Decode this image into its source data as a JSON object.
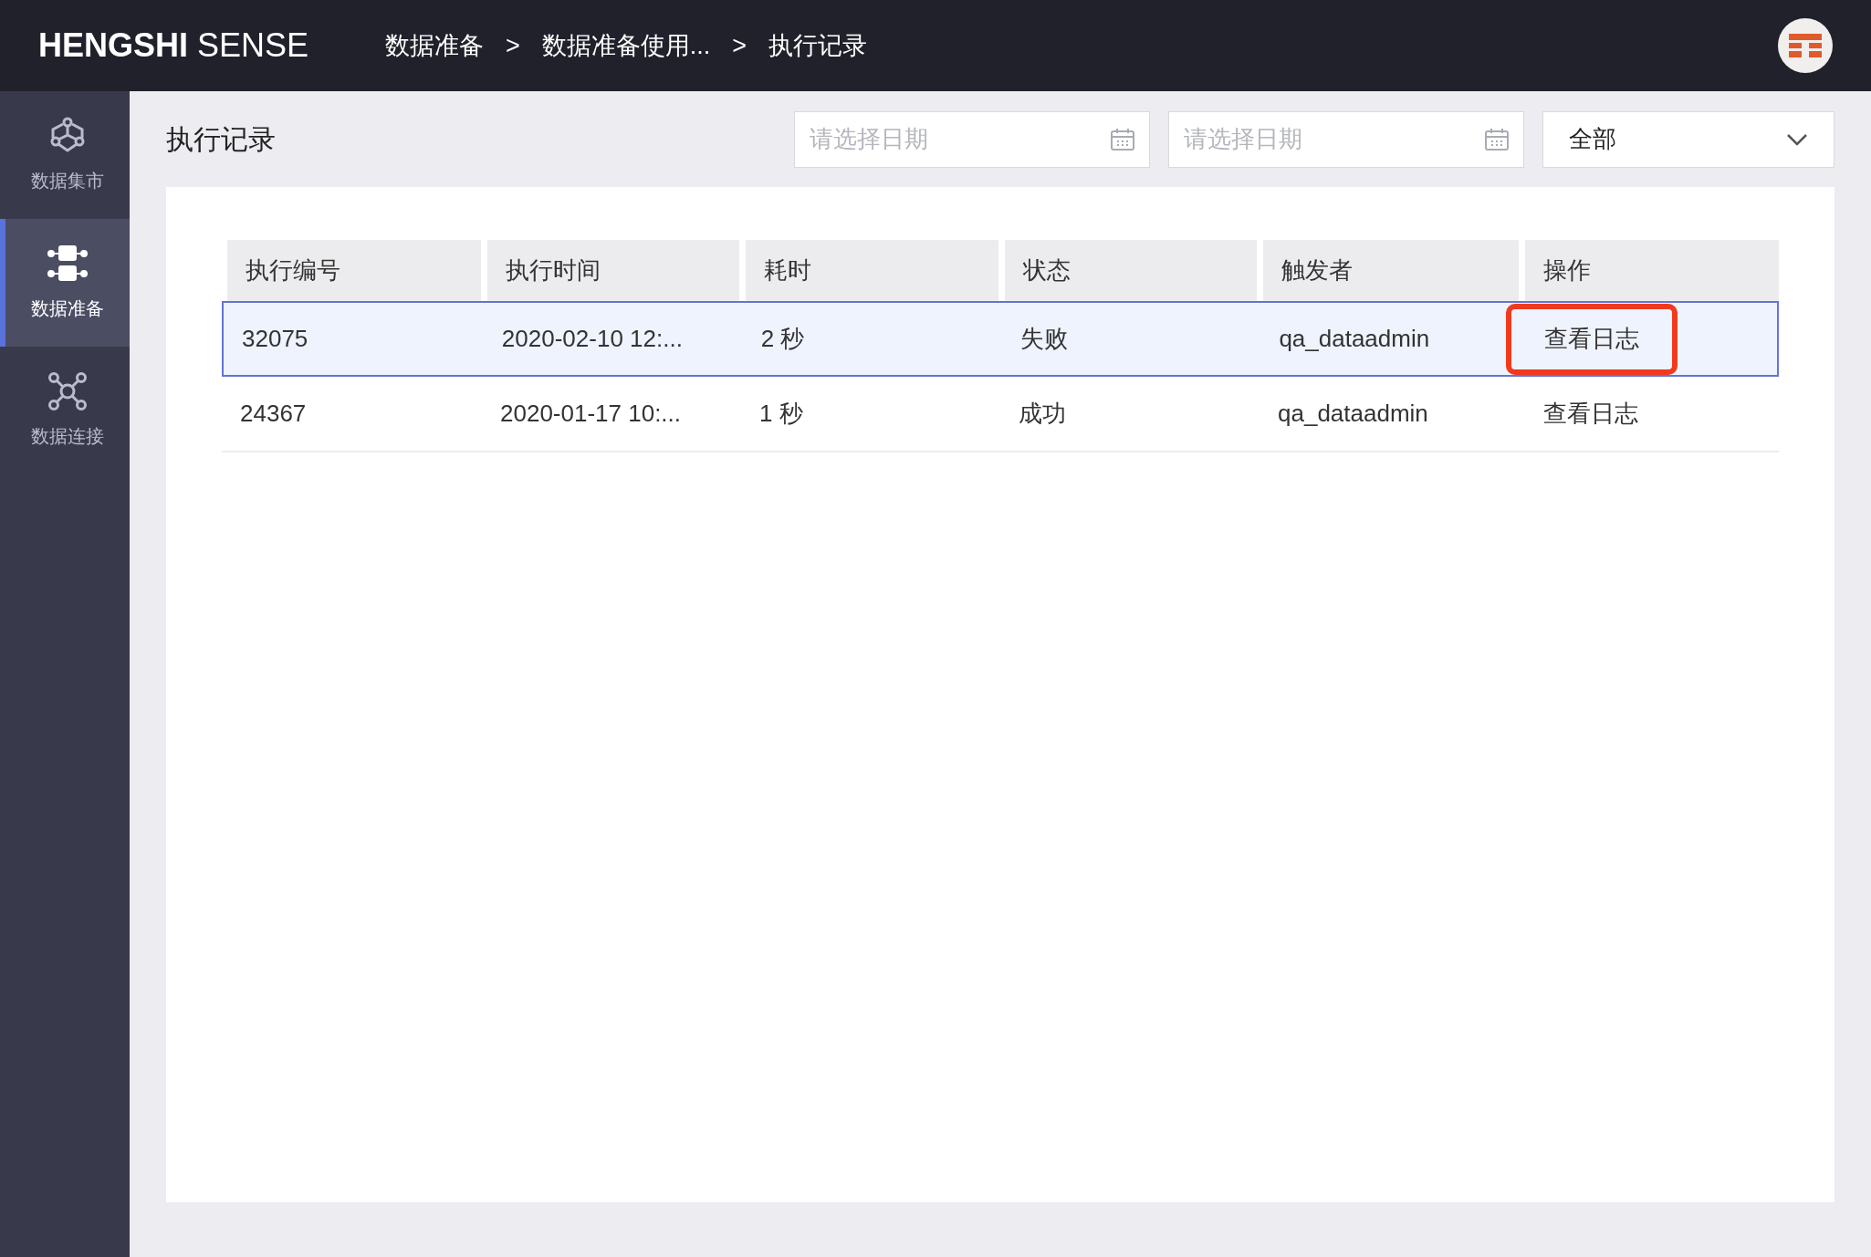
{
  "header": {
    "logo_bold": "HENGSHI",
    "logo_light": "SENSE",
    "breadcrumb": [
      "数据准备",
      "数据准备使用...",
      "执行记录"
    ],
    "separator": ">"
  },
  "sidebar": {
    "items": [
      {
        "kind": "market",
        "label": "数据集市",
        "selected": false
      },
      {
        "kind": "prep",
        "label": "数据准备",
        "selected": true
      },
      {
        "kind": "connect",
        "label": "数据连接",
        "selected": false
      }
    ]
  },
  "page": {
    "title": "执行记录",
    "date_from": {
      "placeholder": "请选择日期"
    },
    "date_to": {
      "placeholder": "请选择日期"
    },
    "status_filter": {
      "value": "全部"
    }
  },
  "table": {
    "columns": [
      "执行编号",
      "执行时间",
      "耗时",
      "状态",
      "触发者",
      "操作"
    ],
    "rows": [
      {
        "cells": [
          "32075",
          "2020-02-10 12:...",
          "2 秒",
          "失败",
          "qa_dataadmin"
        ],
        "action": "查看日志",
        "selected": true,
        "highlighted": true
      },
      {
        "cells": [
          "24367",
          "2020-01-17 10:...",
          "1 秒",
          "成功",
          "qa_dataadmin"
        ],
        "action": "查看日志",
        "selected": false,
        "highlighted": false
      }
    ]
  }
}
